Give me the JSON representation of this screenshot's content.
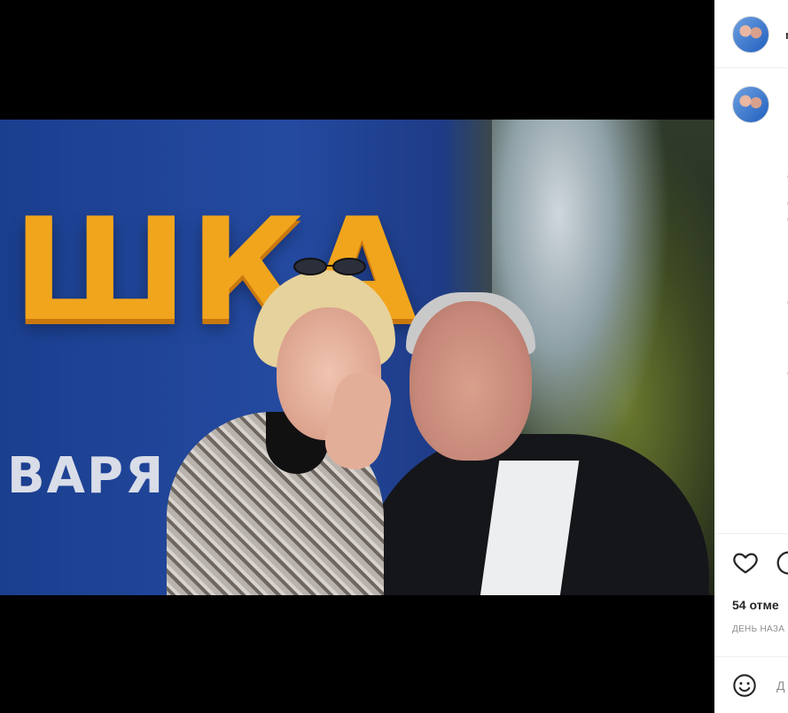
{
  "media": {
    "banner_text": "ШКА",
    "banner_subtext": "ВАРЯ"
  },
  "panel": {
    "username": "m",
    "likes_text": "54 отме",
    "timestamp_text": "ДЕНЬ НАЗА",
    "comment_placeholder": "Д"
  },
  "icons": {
    "like": "heart-icon",
    "comment": "comment-icon",
    "emoji": "emoji-icon"
  },
  "colors": {
    "panel_bg": "#ffffff",
    "text_primary": "#262626",
    "text_secondary": "#8e8e8e",
    "divider": "#efefef"
  }
}
